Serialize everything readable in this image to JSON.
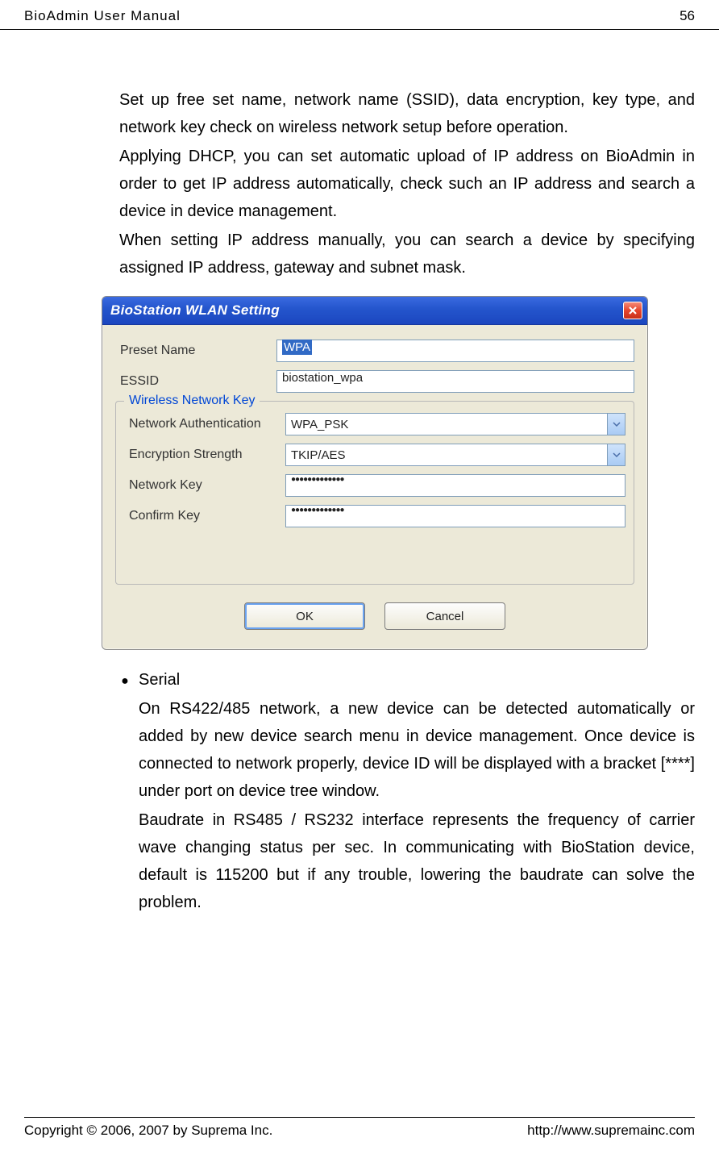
{
  "header": {
    "doc_title": "BioAdmin  User  Manual",
    "page_number": "56"
  },
  "intro": {
    "para1": "Set up free set name, network name (SSID), data encryption, key type, and network key check on wireless network setup before operation.",
    "para2": "Applying DHCP, you can set automatic upload of IP address on BioAdmin in order to get IP address automatically, check such an IP address and search a device in device management.",
    "para3": "When setting IP address manually, you can search a device by specifying assigned IP address, gateway and subnet mask."
  },
  "dialog": {
    "title": "BioStation WLAN Setting",
    "labels": {
      "preset": "Preset Name",
      "essid": "ESSID",
      "legend": "Wireless Network Key",
      "netauth": "Network Authentication",
      "encstr": "Encryption Strength",
      "netkey": "Network Key",
      "confkey": "Confirm Key"
    },
    "values": {
      "preset": "WPA",
      "essid": "biostation_wpa",
      "netauth": "WPA_PSK",
      "encstr": "TKIP/AES",
      "netkey": "●●●●●●●●●●●●●",
      "confkey": "●●●●●●●●●●●●●"
    },
    "buttons": {
      "ok": "OK",
      "cancel": "Cancel"
    }
  },
  "serial": {
    "heading": "Serial",
    "para1": "On RS422/485 network, a new device can be detected automatically or added by new device search menu in device management. Once device is connected to network properly, device ID will be displayed with a bracket [****] under port on device tree window.",
    "para2": "Baudrate in RS485 / RS232 interface represents the frequency of carrier wave changing status per sec. In communicating with BioStation device, default is 115200 but if any trouble, lowering the baudrate can solve the problem."
  },
  "footer": {
    "copyright": "Copyright © 2006, 2007 by Suprema Inc.",
    "url": "http://www.supremainc.com"
  }
}
